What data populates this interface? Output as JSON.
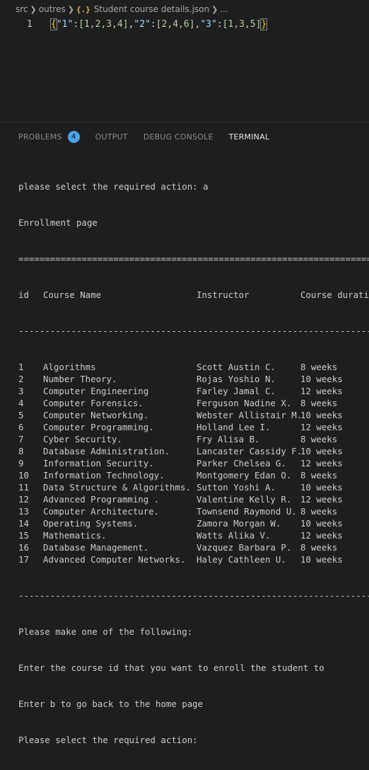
{
  "breadcrumb": {
    "parts": [
      "src",
      "outres"
    ],
    "file_icon": "{.}",
    "file_name": "Student course details.json",
    "more": "..."
  },
  "editor": {
    "line_number": "1",
    "json_text": {
      "open": "{",
      "k1": "\"1\"",
      "v1": "[1,2,3,4]",
      "k2": "\"2\"",
      "v2": "[2,4,6]",
      "k3": "\"3\"",
      "v3": "[1,3,5]",
      "close": "}"
    }
  },
  "panel": {
    "tabs": [
      {
        "label": "PROBLEMS",
        "badge": "4"
      },
      {
        "label": "OUTPUT"
      },
      {
        "label": "DEBUG CONSOLE"
      },
      {
        "label": "TERMINAL"
      }
    ],
    "active_tab": "TERMINAL"
  },
  "terminal": {
    "prompt_line": "please select the required action: a",
    "page_title": "Enrollment page",
    "separator_double": "=================================================================================",
    "separator_dash": "---------------------------------------------------------------------------------",
    "headers": {
      "id": "id",
      "name": "Course Name",
      "instructor": "Instructor",
      "duration": "Course duration"
    },
    "rows": [
      {
        "id": "1",
        "name": "Algorithms",
        "instructor": "Scott Austin C.",
        "duration": "8 weeks"
      },
      {
        "id": "2",
        "name": "Number Theory.",
        "instructor": "Rojas Yoshio N.",
        "duration": "10 weeks"
      },
      {
        "id": "3",
        "name": "Computer Engineering",
        "instructor": "Farley Jamal C.",
        "duration": "12 weeks"
      },
      {
        "id": "4",
        "name": "Computer Forensics.",
        "instructor": "Ferguson Nadine X.",
        "duration": "8 weeks"
      },
      {
        "id": "5",
        "name": "Computer Networking.",
        "instructor": "Webster Allistair M.",
        "duration": "10 weeks"
      },
      {
        "id": "6",
        "name": "Computer Programming.",
        "instructor": "Holland Lee I.",
        "duration": "12 weeks"
      },
      {
        "id": "7",
        "name": "Cyber Security.",
        "instructor": "Fry Alisa B.",
        "duration": "8 weeks"
      },
      {
        "id": "8",
        "name": "Database Administration.",
        "instructor": "Lancaster Cassidy F.",
        "duration": "10 weeks"
      },
      {
        "id": "9",
        "name": "Information Security.",
        "instructor": "Parker Chelsea G.",
        "duration": "12 weeks"
      },
      {
        "id": "10",
        "name": "Information Technology.",
        "instructor": "Montgomery Edan O.",
        "duration": "8 weeks"
      },
      {
        "id": "11",
        "name": "Data Structure & Algorithms.",
        "instructor": "Sutton Yoshi A.",
        "duration": "10 weeks"
      },
      {
        "id": "12",
        "name": "Advanced Programming .",
        "instructor": "Valentine Kelly R.",
        "duration": "12 weeks"
      },
      {
        "id": "13",
        "name": "Computer Architecture.",
        "instructor": "Townsend Raymond U.",
        "duration": "8 weeks"
      },
      {
        "id": "14",
        "name": "Operating Systems.",
        "instructor": "Zamora Morgan W.",
        "duration": "10 weeks"
      },
      {
        "id": "15",
        "name": "Mathematics.",
        "instructor": "Watts Alika V.",
        "duration": "12 weeks"
      },
      {
        "id": "16",
        "name": "Database Management.",
        "instructor": "Vazquez Barbara P.",
        "duration": "8 weeks"
      },
      {
        "id": "17",
        "name": "Advanced Computer Networks.",
        "instructor": "Haley Cathleen U.",
        "duration": "10 weeks"
      }
    ],
    "footer": [
      "Please make one of the following:",
      "Enter the course id that you want to enroll the student to",
      "Enter b to go back to the home page",
      "Please select the required action:"
    ]
  }
}
